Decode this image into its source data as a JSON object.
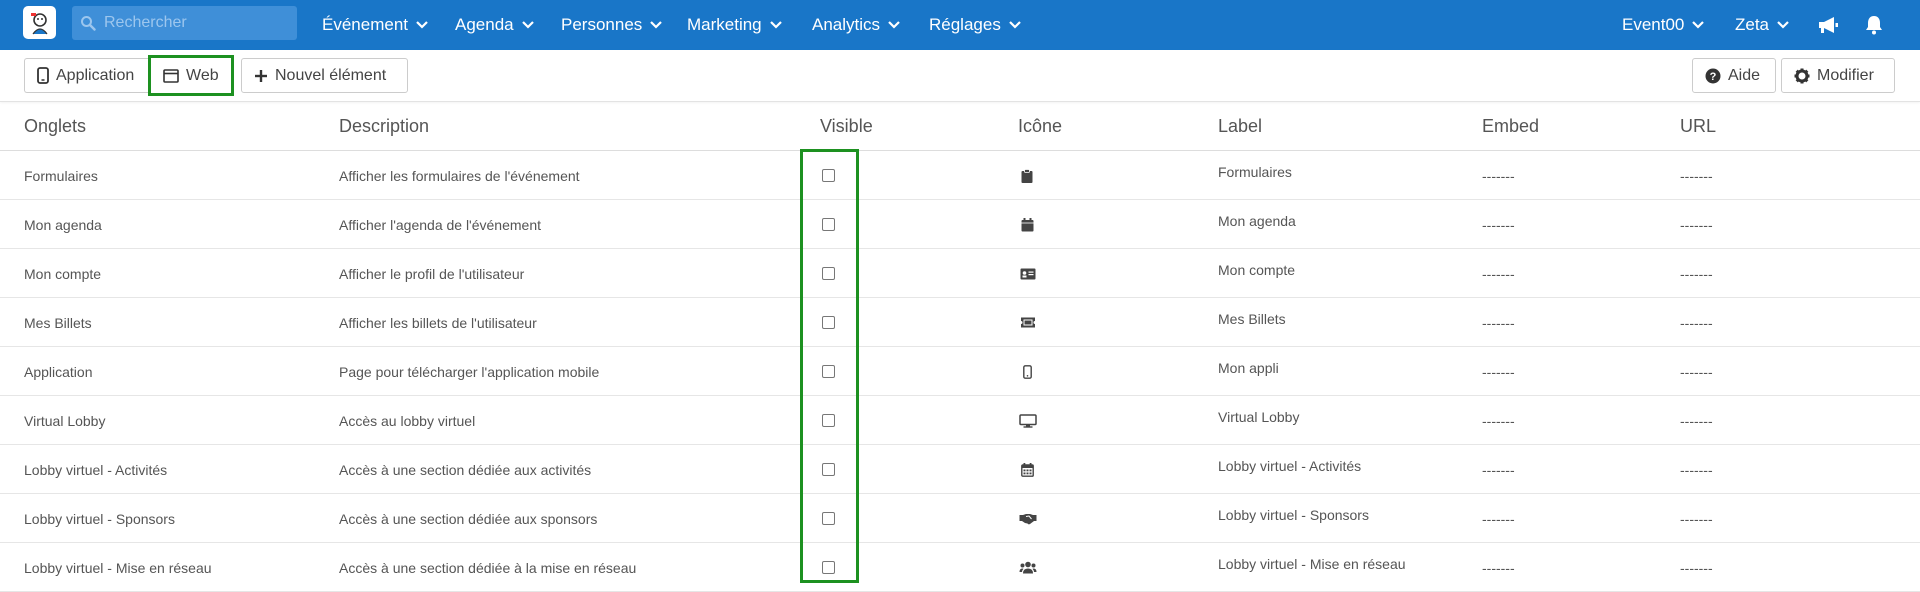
{
  "navbar": {
    "search_placeholder": "Rechercher",
    "menu": [
      {
        "label": "Événement"
      },
      {
        "label": "Agenda"
      },
      {
        "label": "Personnes"
      },
      {
        "label": "Marketing"
      },
      {
        "label": "Analytics"
      },
      {
        "label": "Réglages"
      }
    ],
    "event_selector": "Event00",
    "user_menu": "Zeta",
    "icons": [
      "megaphone-icon",
      "bell-icon"
    ]
  },
  "toolbar": {
    "application_label": "Application",
    "web_label": "Web",
    "new_item_label": "Nouvel élément",
    "help_label": "Aide",
    "edit_label": "Modifier"
  },
  "table": {
    "columns": [
      "Onglets",
      "Description",
      "Visible",
      "Icône",
      "Label",
      "Embed",
      "URL"
    ],
    "rows": [
      {
        "tab": "Formulaires",
        "description": "Afficher les formulaires de l'événement",
        "visible": false,
        "icon": "clipboard-icon",
        "label": "Formulaires",
        "embed": "-------",
        "url": "-------"
      },
      {
        "tab": "Mon agenda",
        "description": "Afficher l'agenda de l'événement",
        "visible": false,
        "icon": "calendar-icon",
        "label": "Mon agenda",
        "embed": "-------",
        "url": "-------"
      },
      {
        "tab": "Mon compte",
        "description": "Afficher le profil de l'utilisateur",
        "visible": false,
        "icon": "id-card-icon",
        "label": "Mon compte",
        "embed": "-------",
        "url": "-------"
      },
      {
        "tab": "Mes Billets",
        "description": "Afficher les billets de l'utilisateur",
        "visible": false,
        "icon": "ticket-icon",
        "label": "Mes Billets",
        "embed": "-------",
        "url": "-------"
      },
      {
        "tab": "Application",
        "description": "Page pour télécharger l'application mobile",
        "visible": false,
        "icon": "mobile-icon",
        "label": "Mon appli",
        "embed": "-------",
        "url": "-------"
      },
      {
        "tab": "Virtual Lobby",
        "description": "Accès au lobby virtuel",
        "visible": false,
        "icon": "desktop-icon",
        "label": "Virtual Lobby",
        "embed": "-------",
        "url": "-------"
      },
      {
        "tab": "Lobby virtuel - Activités",
        "description": "Accès à une section dédiée aux activités",
        "visible": false,
        "icon": "calendar-grid-icon",
        "label": "Lobby virtuel - Activités",
        "embed": "-------",
        "url": "-------"
      },
      {
        "tab": "Lobby virtuel - Sponsors",
        "description": "Accès à une section dédiée aux sponsors",
        "visible": false,
        "icon": "handshake-icon",
        "label": "Lobby virtuel - Sponsors",
        "embed": "-------",
        "url": "-------"
      },
      {
        "tab": "Lobby virtuel - Mise en réseau",
        "description": "Accès à une section dédiée à la mise en réseau",
        "visible": false,
        "icon": "users-icon",
        "label": "Lobby virtuel - Mise en réseau",
        "embed": "-------",
        "url": "-------"
      }
    ]
  },
  "colors": {
    "navbar_bg": "#1976c8",
    "highlight": "#1d9120"
  }
}
